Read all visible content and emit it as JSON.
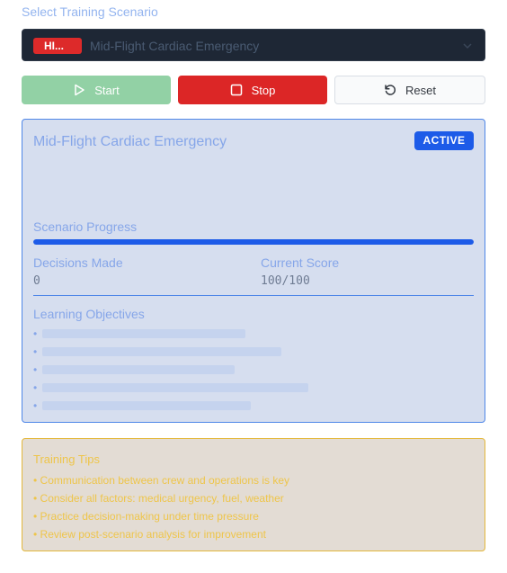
{
  "header": {
    "label": "Select Training Scenario"
  },
  "scenario_select": {
    "badge": "HI...",
    "selected": "Mid-Flight Cardiac Emergency",
    "icon": "chevron-down-icon"
  },
  "controls": {
    "start_label": "Start",
    "stop_label": "Stop",
    "reset_label": "Reset",
    "start_color": "#92d1a5",
    "stop_color": "#dc2626"
  },
  "scenario": {
    "title": "Mid-Flight Cardiac Emergency",
    "status": "ACTIVE",
    "description": "",
    "progress_label": "Scenario Progress",
    "progress_fraction": 1.0,
    "decisions_label": "Decisions Made",
    "decisions_value": "0",
    "score_label": "Current Score",
    "score_value": "100/100",
    "objectives_title": "Learning Objectives",
    "objectives": [
      "",
      "",
      "",
      "",
      ""
    ]
  },
  "tips": {
    "title": "Training Tips",
    "items": [
      "• Communication between crew and operations is key",
      "• Consider all factors: medical urgency, fuel, weather",
      "• Practice decision-making under time pressure",
      "• Review post-scenario analysis for improvement"
    ]
  },
  "colors": {
    "accent": "#1d5be8",
    "panel_bg": "#d6deef",
    "tips_bg": "#e3dcd4",
    "tips_border": "#e4b83c"
  }
}
